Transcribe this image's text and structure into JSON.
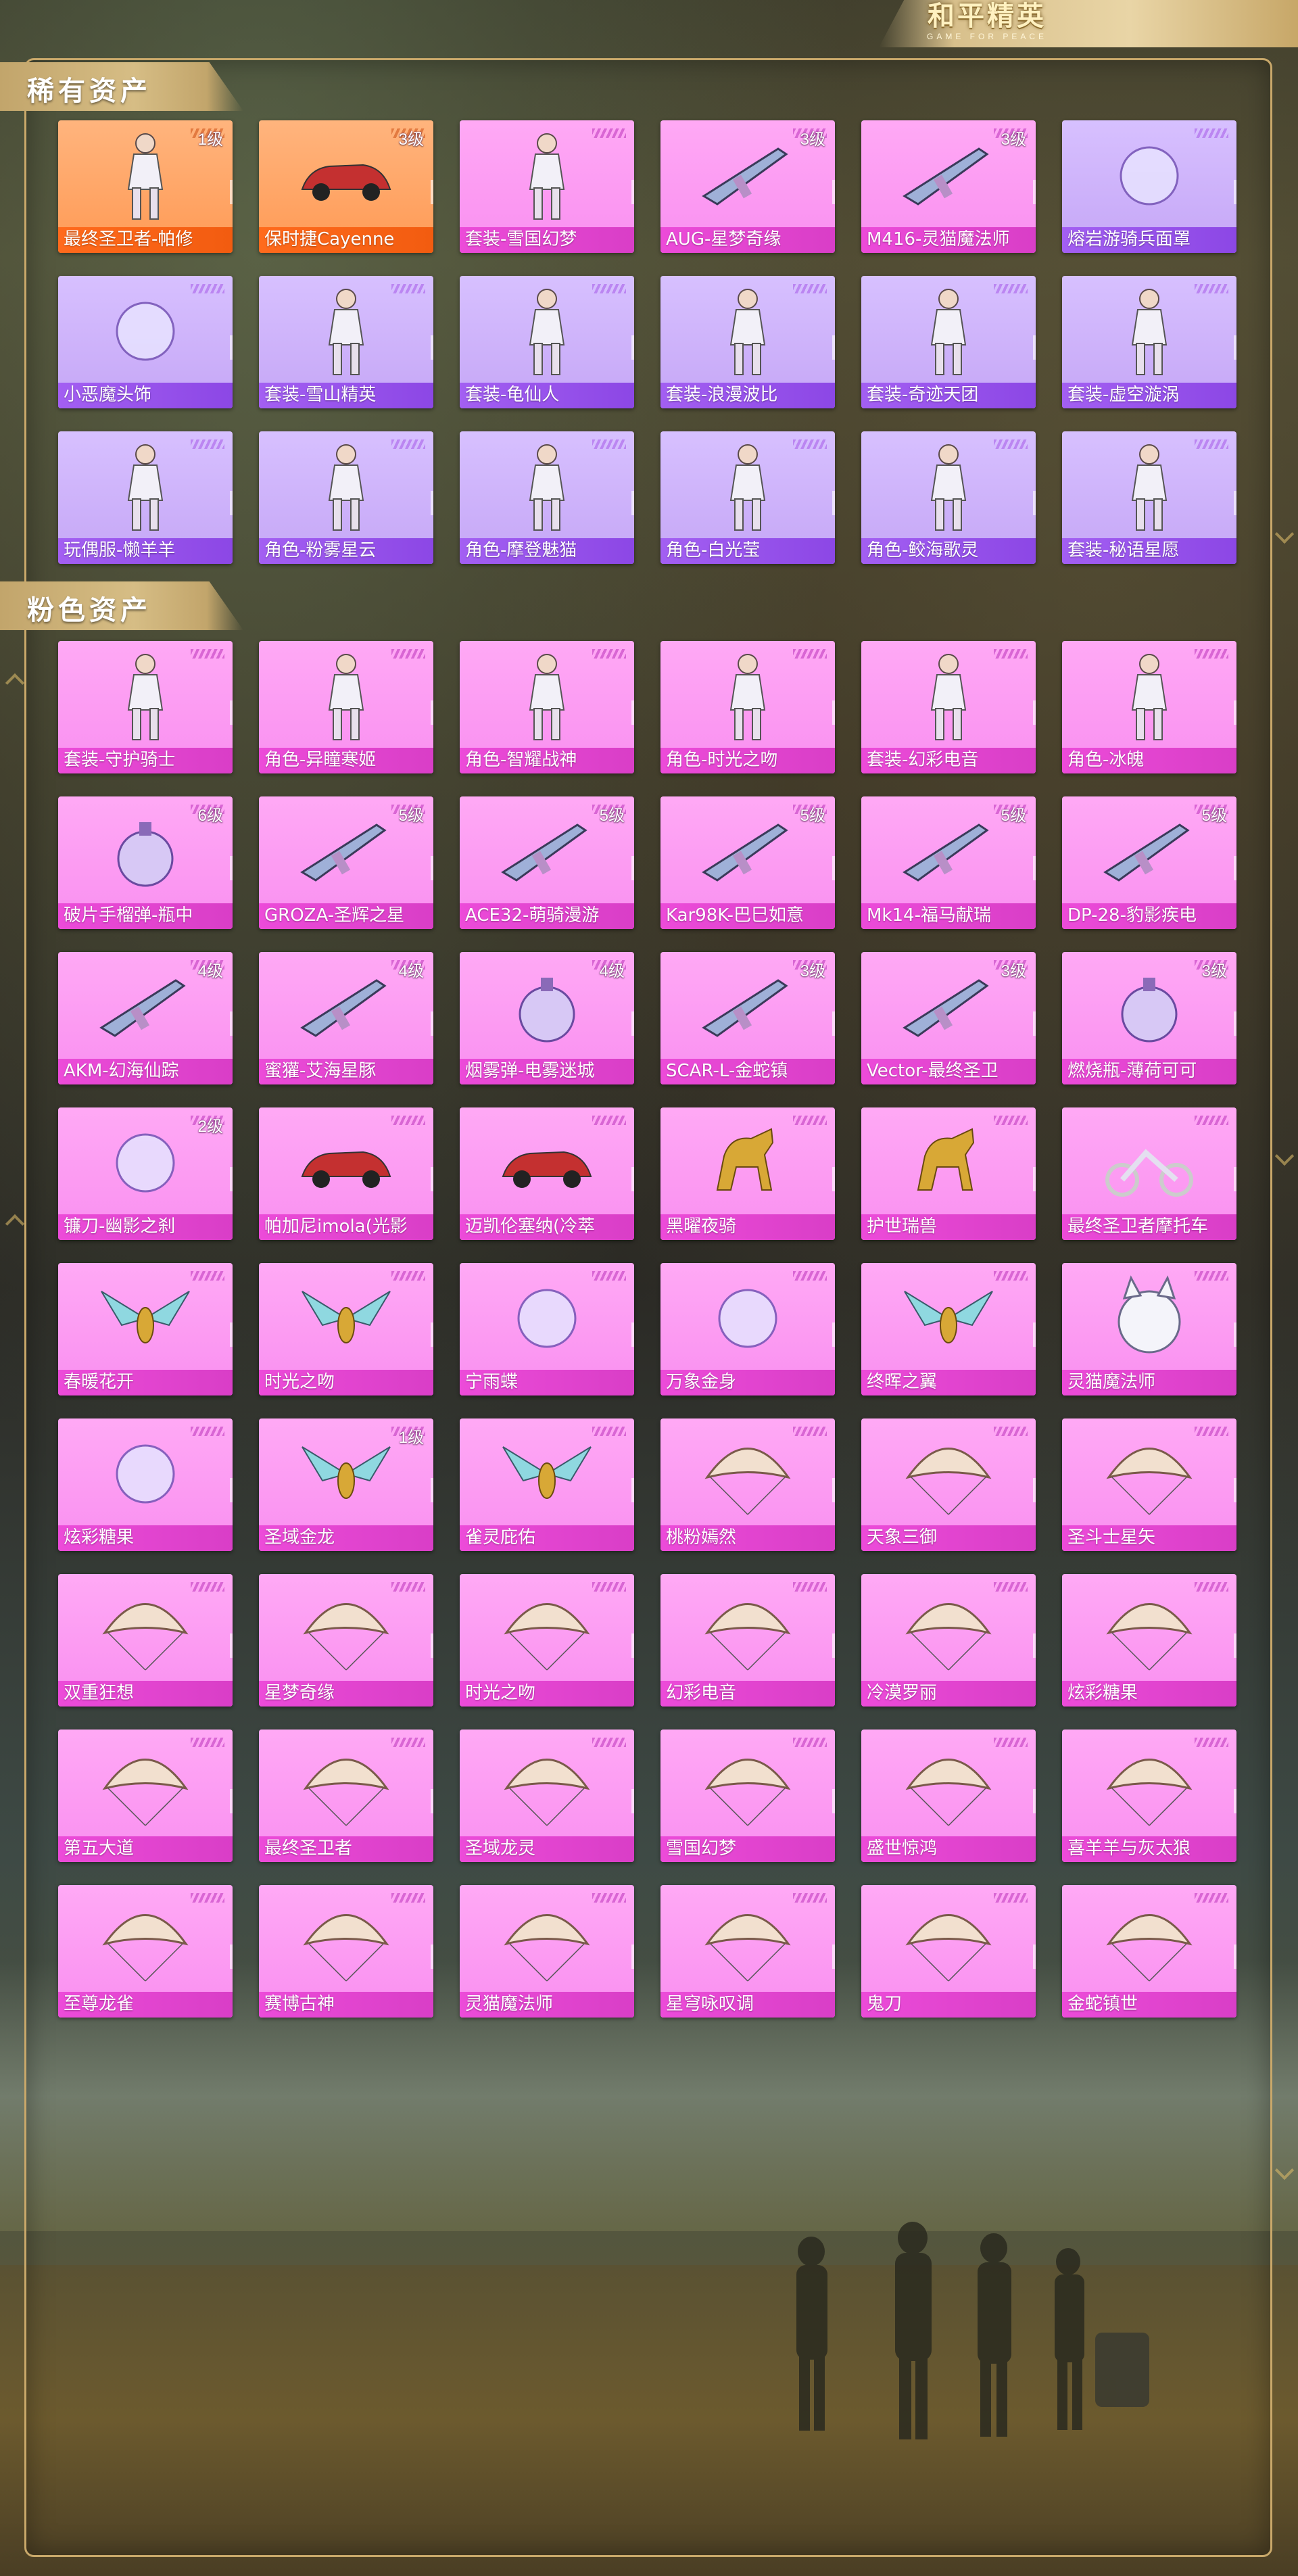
{
  "brand": {
    "logo_text": "和平精英",
    "logo_sub": "GAME FOR PEACE"
  },
  "sections": [
    {
      "title": "稀有资产",
      "items": [
        {
          "name": "最终圣卫者-帕修",
          "level": "1级",
          "color": "orange",
          "icon": "character-icon"
        },
        {
          "name": "保时捷Cayenne",
          "level": "3级",
          "color": "orange",
          "icon": "car-icon"
        },
        {
          "name": "套装-雪国幻梦",
          "level": "",
          "color": "pink",
          "icon": "outfit-icon"
        },
        {
          "name": "AUG-星梦奇缘",
          "level": "3级",
          "color": "pink",
          "icon": "rifle-icon"
        },
        {
          "name": "M416-灵猫魔法师",
          "level": "3级",
          "color": "pink",
          "icon": "rifle-icon"
        },
        {
          "name": "熔岩游骑兵面罩",
          "level": "",
          "color": "purple",
          "icon": "mask-icon"
        },
        {
          "name": "小恶魔头饰",
          "level": "",
          "color": "purple",
          "icon": "headwear-icon"
        },
        {
          "name": "套装-雪山精英",
          "level": "",
          "color": "purple",
          "icon": "outfit-icon"
        },
        {
          "name": "套装-龟仙人",
          "level": "",
          "color": "purple",
          "icon": "outfit-icon"
        },
        {
          "name": "套装-浪漫波比",
          "level": "",
          "color": "purple",
          "icon": "outfit-icon"
        },
        {
          "name": "套装-奇迹天团",
          "level": "",
          "color": "purple",
          "icon": "outfit-icon"
        },
        {
          "name": "套装-虚空漩涡",
          "level": "",
          "color": "purple",
          "icon": "outfit-icon"
        },
        {
          "name": "玩偶服-懒羊羊",
          "level": "",
          "color": "purple",
          "icon": "outfit-icon"
        },
        {
          "name": "角色-粉雾星云",
          "level": "",
          "color": "purple",
          "icon": "character-icon"
        },
        {
          "name": "角色-摩登魅猫",
          "level": "",
          "color": "purple",
          "icon": "character-icon"
        },
        {
          "name": "角色-白光莹",
          "level": "",
          "color": "purple",
          "icon": "character-icon"
        },
        {
          "name": "角色-鲛海歌灵",
          "level": "",
          "color": "purple",
          "icon": "character-icon"
        },
        {
          "name": "套装-秘语星愿",
          "level": "",
          "color": "purple",
          "icon": "outfit-icon"
        }
      ]
    },
    {
      "title": "粉色资产",
      "items": [
        {
          "name": "套装-守护骑士",
          "level": "",
          "color": "pink",
          "icon": "outfit-icon"
        },
        {
          "name": "角色-异瞳寒姬",
          "level": "",
          "color": "pink",
          "icon": "character-icon"
        },
        {
          "name": "角色-智耀战神",
          "level": "",
          "color": "pink",
          "icon": "character-icon"
        },
        {
          "name": "角色-时光之吻",
          "level": "",
          "color": "pink",
          "icon": "character-icon"
        },
        {
          "name": "套装-幻彩电音",
          "level": "",
          "color": "pink",
          "icon": "outfit-icon"
        },
        {
          "name": "角色-冰魄",
          "level": "",
          "color": "pink",
          "icon": "character-icon"
        },
        {
          "name": "破片手榴弹-瓶中",
          "level": "6级",
          "color": "pink",
          "icon": "grenade-icon"
        },
        {
          "name": "GROZA-圣辉之星",
          "level": "5级",
          "color": "pink",
          "icon": "rifle-icon"
        },
        {
          "name": "ACE32-萌骑漫游",
          "level": "5级",
          "color": "pink",
          "icon": "rifle-icon"
        },
        {
          "name": "Kar98K-巴巳如意",
          "level": "5级",
          "color": "pink",
          "icon": "sniper-icon"
        },
        {
          "name": "Mk14-福马献瑞",
          "level": "5级",
          "color": "pink",
          "icon": "rifle-icon"
        },
        {
          "name": "DP-28-豹影疾电",
          "level": "5级",
          "color": "pink",
          "icon": "machine-gun-icon"
        },
        {
          "name": "AKM-幻海仙踪",
          "level": "4级",
          "color": "pink",
          "icon": "rifle-icon"
        },
        {
          "name": "蜜獾-艾海星豚",
          "level": "4级",
          "color": "pink",
          "icon": "rifle-icon"
        },
        {
          "name": "烟雾弹-电雾迷城",
          "level": "4级",
          "color": "pink",
          "icon": "smoke-grenade-icon"
        },
        {
          "name": "SCAR-L-金蛇镇",
          "level": "3级",
          "color": "pink",
          "icon": "rifle-icon"
        },
        {
          "name": "Vector-最终圣卫",
          "level": "3级",
          "color": "pink",
          "icon": "smg-icon"
        },
        {
          "name": "燃烧瓶-薄荷可可",
          "level": "3级",
          "color": "pink",
          "icon": "molotov-icon"
        },
        {
          "name": "镰刀-幽影之刹",
          "level": "2级",
          "color": "pink",
          "icon": "sickle-icon"
        },
        {
          "name": "帕加尼imola(光影",
          "level": "",
          "color": "pink",
          "icon": "car-icon"
        },
        {
          "name": "迈凯伦塞纳(冷萃",
          "level": "",
          "color": "pink",
          "icon": "car-icon"
        },
        {
          "name": "黑曜夜骑",
          "level": "",
          "color": "pink",
          "icon": "horse-icon"
        },
        {
          "name": "护世瑞兽",
          "level": "",
          "color": "pink",
          "icon": "horse-icon"
        },
        {
          "name": "最终圣卫者摩托车",
          "level": "",
          "color": "pink",
          "icon": "motorcycle-icon"
        },
        {
          "name": "春暖花开",
          "level": "",
          "color": "pink",
          "icon": "glider-icon"
        },
        {
          "name": "时光之吻",
          "level": "",
          "color": "pink",
          "icon": "glider-icon"
        },
        {
          "name": "宁雨蝶",
          "level": "",
          "color": "pink",
          "icon": "effect-icon"
        },
        {
          "name": "万象金身",
          "level": "",
          "color": "pink",
          "icon": "effect-icon"
        },
        {
          "name": "终晖之翼",
          "level": "",
          "color": "pink",
          "icon": "wings-icon"
        },
        {
          "name": "灵猫魔法师",
          "level": "",
          "color": "pink",
          "icon": "cat-icon"
        },
        {
          "name": "炫彩糖果",
          "level": "",
          "color": "pink",
          "icon": "backpack-icon"
        },
        {
          "name": "圣域金龙",
          "level": "1级",
          "color": "pink",
          "icon": "dragon-icon"
        },
        {
          "name": "雀灵庇佑",
          "level": "",
          "color": "pink",
          "icon": "bird-icon"
        },
        {
          "name": "桃粉嫣然",
          "level": "",
          "color": "pink",
          "icon": "parachute-icon"
        },
        {
          "name": "天象三御",
          "level": "",
          "color": "pink",
          "icon": "parachute-icon"
        },
        {
          "name": "圣斗士星矢",
          "level": "",
          "color": "pink",
          "icon": "parachute-icon"
        },
        {
          "name": "双重狂想",
          "level": "",
          "color": "pink",
          "icon": "parachute-icon"
        },
        {
          "name": "星梦奇缘",
          "level": "",
          "color": "pink",
          "icon": "parachute-icon"
        },
        {
          "name": "时光之吻",
          "level": "",
          "color": "pink",
          "icon": "parachute-icon"
        },
        {
          "name": "幻彩电音",
          "level": "",
          "color": "pink",
          "icon": "parachute-icon"
        },
        {
          "name": "冷漠罗丽",
          "level": "",
          "color": "pink",
          "icon": "parachute-icon"
        },
        {
          "name": "炫彩糖果",
          "level": "",
          "color": "pink",
          "icon": "parachute-icon"
        },
        {
          "name": "第五大道",
          "level": "",
          "color": "pink",
          "icon": "parachute-icon"
        },
        {
          "name": "最终圣卫者",
          "level": "",
          "color": "pink",
          "icon": "parachute-icon"
        },
        {
          "name": "圣域龙灵",
          "level": "",
          "color": "pink",
          "icon": "parachute-icon"
        },
        {
          "name": "雪国幻梦",
          "level": "",
          "color": "pink",
          "icon": "parachute-icon"
        },
        {
          "name": "盛世惊鸿",
          "level": "",
          "color": "pink",
          "icon": "parachute-icon"
        },
        {
          "name": "喜羊羊与灰太狼",
          "level": "",
          "color": "pink",
          "icon": "parachute-icon"
        },
        {
          "name": "至尊龙雀",
          "level": "",
          "color": "pink",
          "icon": "parachute-icon"
        },
        {
          "name": "赛博古神",
          "level": "",
          "color": "pink",
          "icon": "parachute-icon"
        },
        {
          "name": "灵猫魔法师",
          "level": "",
          "color": "pink",
          "icon": "parachute-icon"
        },
        {
          "name": "星穹咏叹调",
          "level": "",
          "color": "pink",
          "icon": "parachute-icon"
        },
        {
          "name": "鬼刀",
          "level": "",
          "color": "pink",
          "icon": "parachute-icon"
        },
        {
          "name": "金蛇镇世",
          "level": "",
          "color": "pink",
          "icon": "parachute-icon"
        }
      ]
    }
  ],
  "colors": {
    "orange": "#ff9a55",
    "purple": "#c5a6f6",
    "pink": "#f98ff0",
    "gold": "#c9a86a"
  }
}
